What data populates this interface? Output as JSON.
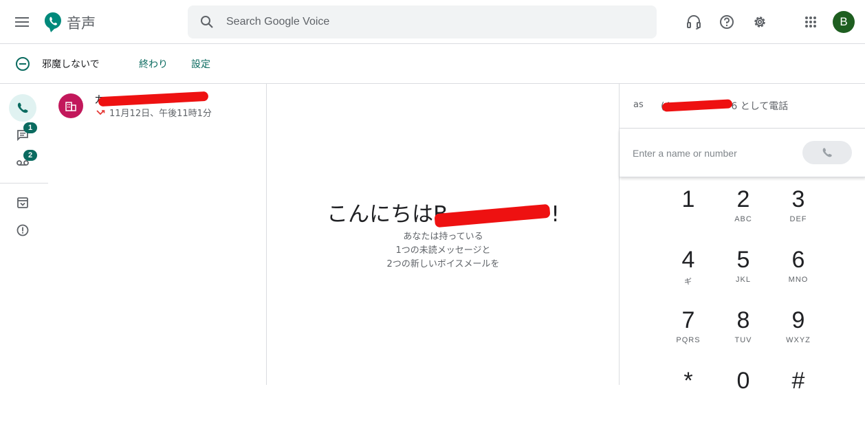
{
  "app": {
    "name": "音声"
  },
  "search": {
    "placeholder": "Search Google Voice"
  },
  "account": {
    "initial": "B"
  },
  "dnd": {
    "label": "邪魔しないで",
    "end_label": "終わり",
    "settings_label": "設定"
  },
  "nav": {
    "messages_badge": "1",
    "voicemail_badge": "2"
  },
  "calls": [
    {
      "name_prefix": "カ",
      "datetime": "11月12日、午後11時1分",
      "type": "missed"
    }
  ],
  "greeting": {
    "hello": "こんにちは",
    "name_initial": "B",
    "name_suffix": "!",
    "line1": "あなたは持っている",
    "line2": "1つの未読メッセージと",
    "line3": "2つの新しいボイスメールを"
  },
  "dialer": {
    "as_label": "as",
    "number_prefix": "(4",
    "number_suffix": "6 として電話",
    "placeholder": "Enter a name or number",
    "keys": [
      {
        "digit": "1",
        "letters": ""
      },
      {
        "digit": "2",
        "letters": "ABC"
      },
      {
        "digit": "3",
        "letters": "DEF"
      },
      {
        "digit": "4",
        "letters": "ギ"
      },
      {
        "digit": "5",
        "letters": "JKL"
      },
      {
        "digit": "6",
        "letters": "MNO"
      },
      {
        "digit": "7",
        "letters": "PQRS"
      },
      {
        "digit": "8",
        "letters": "TUV"
      },
      {
        "digit": "9",
        "letters": "WXYZ"
      },
      {
        "digit": "*",
        "letters": ""
      },
      {
        "digit": "0",
        "letters": ""
      },
      {
        "digit": "#",
        "letters": ""
      }
    ]
  },
  "colors": {
    "accent": "#0b6b60",
    "avatar": "#1e5e20",
    "contact": "#c2185b",
    "redaction": "#ee1111"
  }
}
